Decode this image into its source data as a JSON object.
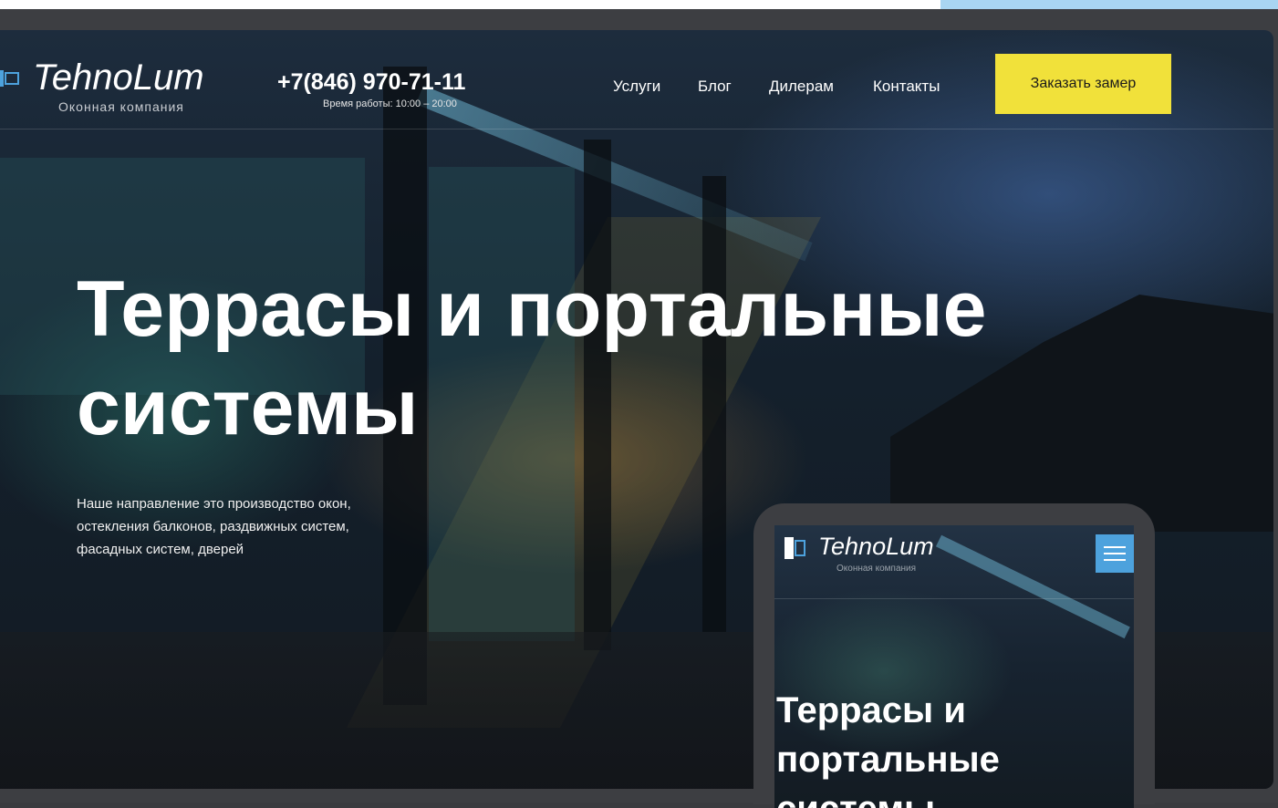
{
  "header": {
    "logo_text": "TehnoLum",
    "logo_subtitle": "Оконная компания",
    "phone": "+7(846) 970-71-11",
    "hours": "Время работы: 10:00 – 20:00",
    "nav": [
      "Услуги",
      "Блог",
      "Дилерам",
      "Контакты"
    ],
    "cta_label": "Заказать замер"
  },
  "hero": {
    "title_line1": "Террасы и портальные",
    "title_line2": "системы",
    "description": "Наше направление это производство окон, остекления балконов, раздвижных систем, фасадных систем, дверей"
  },
  "mobile_preview": {
    "logo_text": "TehnoLum",
    "logo_subtitle": "Оконная компания",
    "title_line1": "Террасы и",
    "title_line2": "портальные",
    "title_line3": "системы"
  },
  "colors": {
    "cta": "#f1e13a",
    "burger": "#4da2dd",
    "frame": "#3d3e42"
  },
  "icons": {
    "logo_mark": "logo-icon",
    "menu": "hamburger-menu-icon"
  }
}
